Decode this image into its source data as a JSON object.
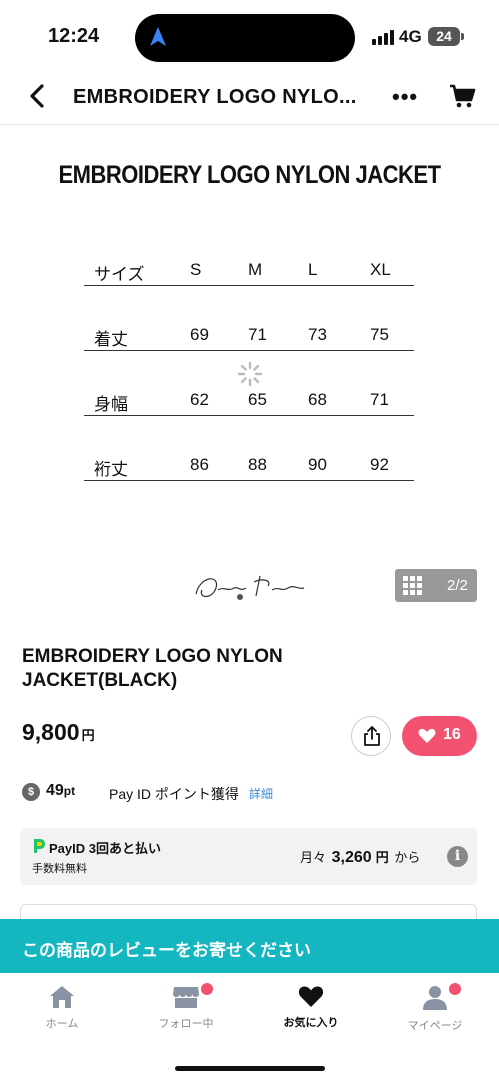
{
  "status_bar": {
    "time": "12:24",
    "network": "4G",
    "battery": "24"
  },
  "navbar": {
    "title": "EMBROIDERY LOGO NYLO...",
    "more_label": "•••"
  },
  "product_image": {
    "heading": "EMBROIDERY LOGO NYLON JACKET",
    "size_table": {
      "header": [
        "サイズ",
        "S",
        "M",
        "L",
        "XL"
      ],
      "rows": [
        [
          "着丈",
          "69",
          "71",
          "73",
          "75"
        ],
        [
          "身幅",
          "62",
          "65",
          "68",
          "71"
        ],
        [
          "裄丈",
          "86",
          "88",
          "90",
          "92"
        ]
      ]
    },
    "gallery_count": "2/2"
  },
  "product": {
    "name": "EMBROIDERY LOGO NYLON JACKET(BLACK)",
    "price": "9,800",
    "price_unit": "円",
    "like_count": "16"
  },
  "points": {
    "coin_label": "$",
    "amount": "49",
    "unit": "pt",
    "text": "Pay ID ポイント獲得",
    "detail_link": "詳細"
  },
  "payid": {
    "brand": "PayID 3回あと払い",
    "fee": "手数料無料",
    "monthly_prefix": "月々",
    "monthly_amount": "3,260",
    "monthly_unit": "円",
    "monthly_suffix": "から",
    "info_label": "i"
  },
  "review_banner": "この商品のレビューをお寄せください",
  "tabs": [
    {
      "label": "ホーム",
      "icon": "home-icon"
    },
    {
      "label": "フォロー中",
      "icon": "store-icon"
    },
    {
      "label": "お気に入り",
      "icon": "heart-icon"
    },
    {
      "label": "マイページ",
      "icon": "user-icon"
    }
  ],
  "colors": {
    "accent_pink": "#f2526f",
    "banner_teal": "#14b7c0",
    "link_blue": "#3a8bd6"
  }
}
